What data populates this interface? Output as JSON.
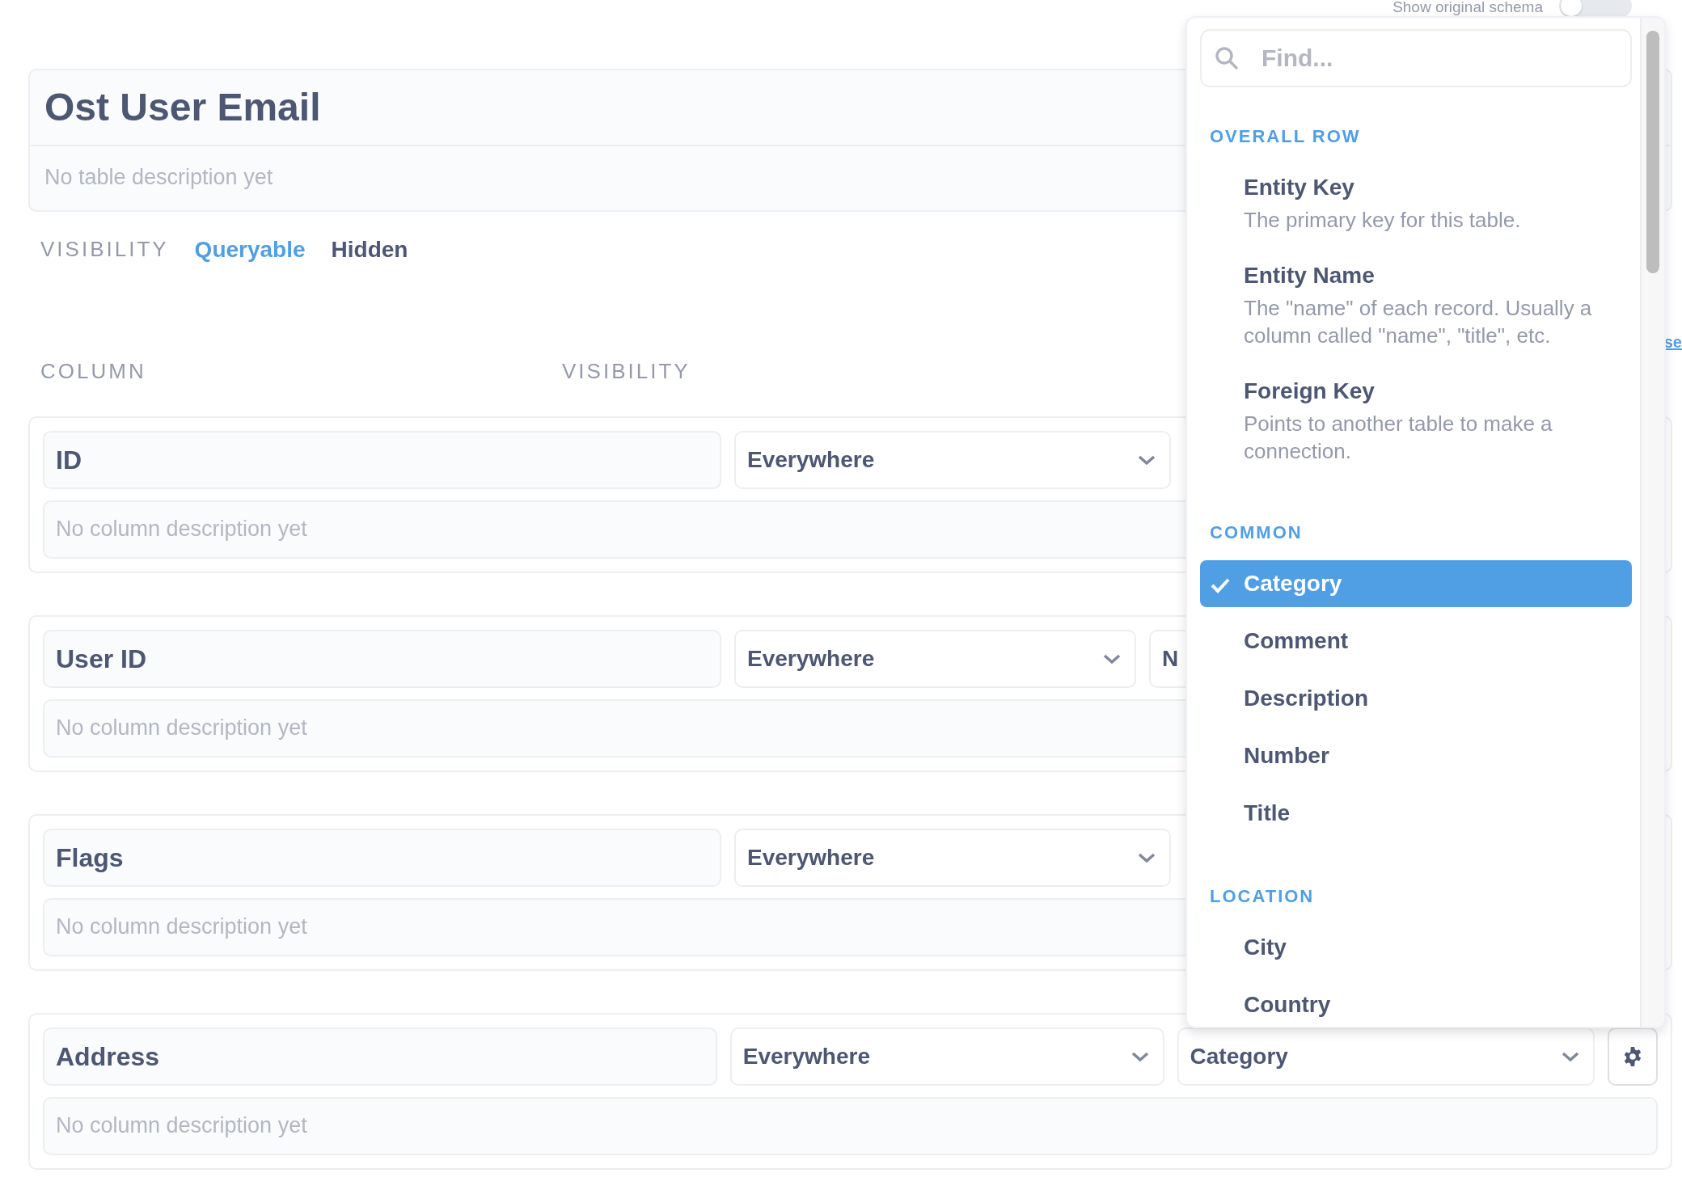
{
  "schema_toggle": {
    "label": "Show original schema",
    "on": false
  },
  "table": {
    "title": "Ost User Email",
    "description_placeholder": "No table description yet"
  },
  "visibility": {
    "label": "VISIBILITY",
    "options": [
      {
        "label": "Queryable",
        "selected": true
      },
      {
        "label": "Hidden",
        "selected": false
      }
    ]
  },
  "column_headers": [
    "COLUMN",
    "VISIBILITY"
  ],
  "side_link": "se",
  "columns": [
    {
      "name": "ID",
      "visibility": "Everywhere",
      "description_placeholder": "No column description yet"
    },
    {
      "name": "User ID",
      "visibility": "Everywhere",
      "field_type": "N",
      "description_placeholder": "No column description yet"
    },
    {
      "name": "Flags",
      "visibility": "Everywhere",
      "description_placeholder": "No column description yet"
    },
    {
      "name": "Address",
      "visibility": "Everywhere",
      "field_type": "Category",
      "settings": true,
      "description_placeholder": "No column description yet"
    }
  ],
  "type_menu": {
    "search_placeholder": "Find...",
    "sections": [
      {
        "title": "OVERALL ROW",
        "items": [
          {
            "label": "Entity Key",
            "description": "The primary key for this table.",
            "selected": false
          },
          {
            "label": "Entity Name",
            "description": "The \"name\" of each record. Usually a column called \"name\", \"title\", etc.",
            "selected": false
          },
          {
            "label": "Foreign Key",
            "description": "Points to another table to make a connection.",
            "selected": false
          }
        ]
      },
      {
        "title": "COMMON",
        "items": [
          {
            "label": "Category",
            "selected": true
          },
          {
            "label": "Comment",
            "selected": false
          },
          {
            "label": "Description",
            "selected": false
          },
          {
            "label": "Number",
            "selected": false
          },
          {
            "label": "Title",
            "selected": false
          }
        ]
      },
      {
        "title": "LOCATION",
        "items": [
          {
            "label": "City",
            "selected": false
          },
          {
            "label": "Country",
            "selected": false
          }
        ]
      }
    ]
  }
}
